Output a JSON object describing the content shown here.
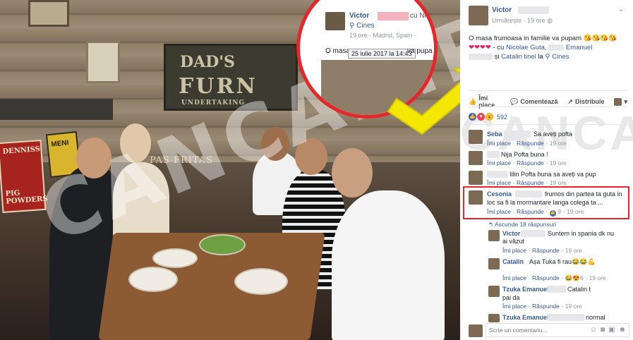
{
  "photo": {
    "sign_line1": "DAD'S",
    "sign_line2": "FURN",
    "sign_line3": "UNDERTAKING",
    "red_sign_line1": "DENNISS",
    "red_sign_line2": "PIG POWDERS",
    "yellow_sign": "MENI",
    "fritas": "PAS FRITAS",
    "watermark": "CANCAN.RO"
  },
  "inset": {
    "author": "Victor",
    "cu": "cu Nic",
    "place": "Cines",
    "time_location": "19 ore · Madrid, Spain ·",
    "text_start": "O masa",
    "tooltip": "25 iulie 2017 la 14:43",
    "text_end": "va pupa"
  },
  "post": {
    "author": "Victor",
    "follow_label": "Urmărește",
    "time": "19 ore",
    "text_main": "O masa frumoasa in familie va pupam",
    "emojis_1": "😘😘😘😘",
    "hearts": "❤❤❤❤",
    "with_label": "- cu",
    "tag1": "Nicolae Guta,",
    "tag2": "Emanuel",
    "and_label": "și",
    "tag3": "Catalin tinel",
    "at_label": "la",
    "place": "Cines"
  },
  "actions": {
    "like": "Îmi place",
    "comment": "Comentează",
    "share": "Distribuie"
  },
  "reactions": {
    "count": "592"
  },
  "comments": [
    {
      "name": "Seba",
      "text": "Sa aveți pofta",
      "like": "Îmi place",
      "reply": "Răspunde",
      "time": "19 ore"
    },
    {
      "name": "",
      "text": "Nija Pofta buna !",
      "like": "Îmi place",
      "reply": "Răspunde",
      "time": "19 ore"
    },
    {
      "name": "",
      "text": "Iilin Pofta buna sa aveți va pup",
      "like": "Îmi place",
      "reply": "Răspunde",
      "time": "19 ore"
    },
    {
      "name": "Cesonia",
      "text": "frumos din partea ta guta in",
      "text2": "loc sa fi la mormantare langa colega ta ...",
      "like": "Îmi place",
      "reply": "Răspunde",
      "likes": "9",
      "time": "19 ore"
    }
  ],
  "hide_replies": "Ascunde 18 răspunsuri",
  "replies": [
    {
      "name": "Victor",
      "text": "Suntem in spania dk nu",
      "text2": "ai văzut",
      "like": "Îmi place",
      "reply": "Răspunde",
      "time": "19 ore"
    },
    {
      "name": "Catalin",
      "text": "Așa Tuka fi rau😂😂💪",
      "like": "Îmi place",
      "reply": "Răspunde",
      "reacts": "😂😍6",
      "time": "19 ore"
    },
    {
      "name": "Tzuka Emanuel",
      "text": "Catalin t",
      "text2": "pai da",
      "like": "Îmi place",
      "reply": "Răspunde",
      "time": "19 ore"
    },
    {
      "name": "Tzuka Emanuel",
      "text": "normal"
    }
  ],
  "comment_input": {
    "placeholder": "Scrie un comentariu..."
  },
  "panel_watermark": "CANCAN.RO"
}
